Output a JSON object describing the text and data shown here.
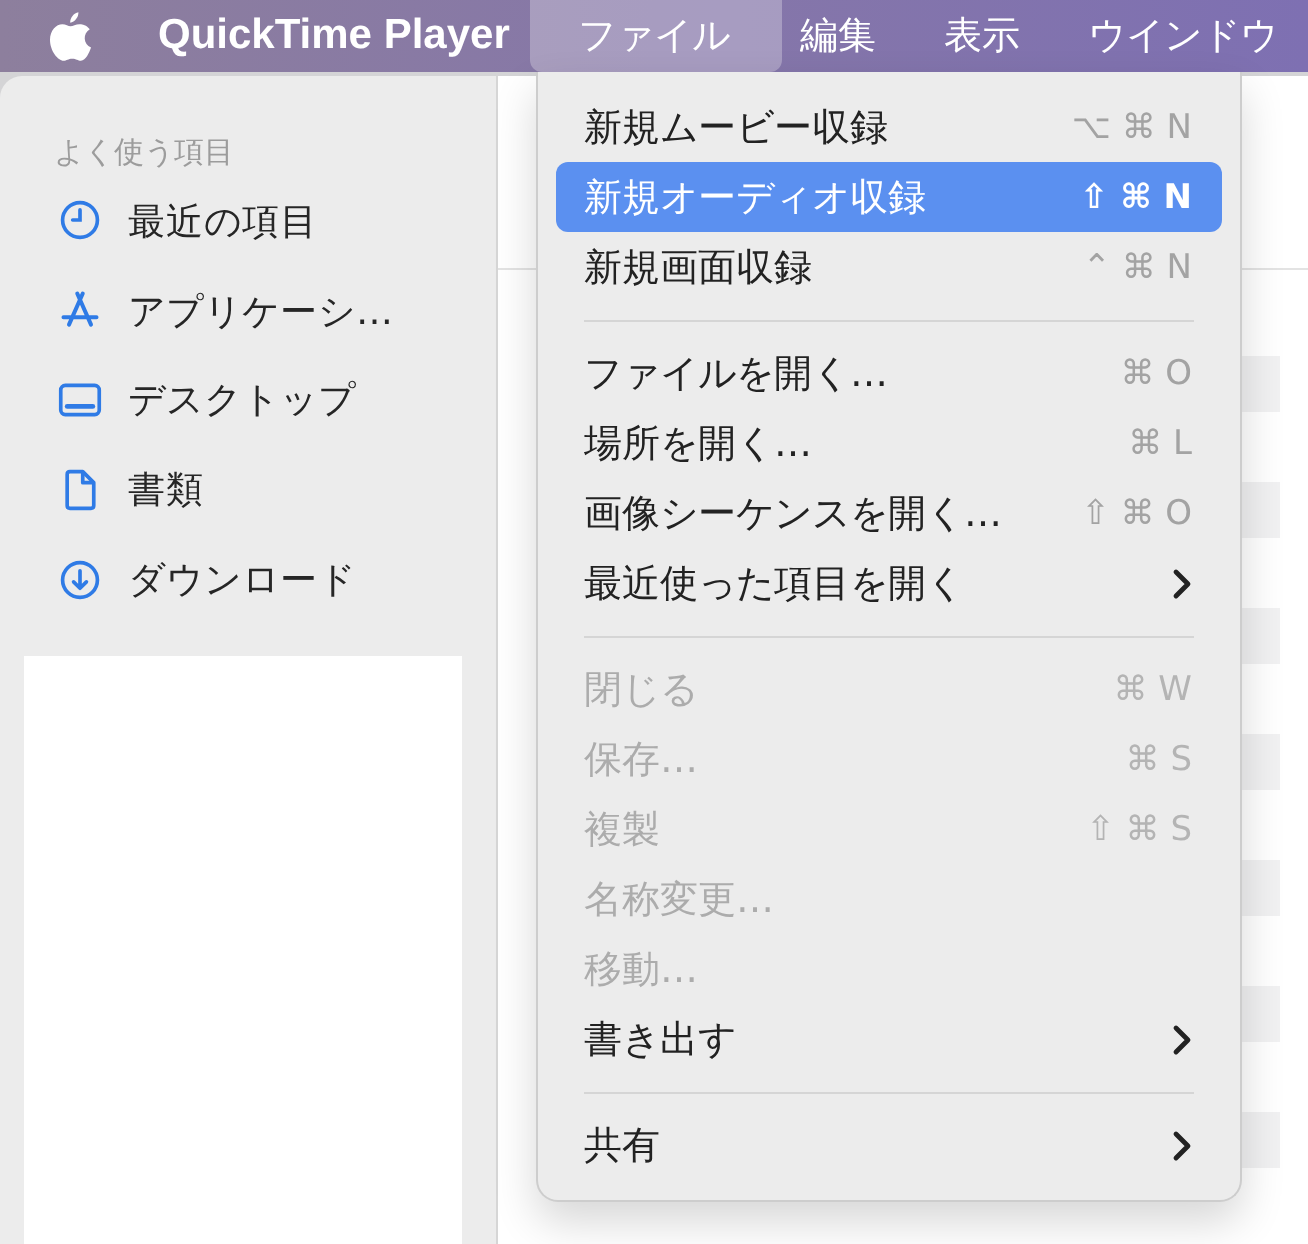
{
  "menu_bar": {
    "app_name": "QuickTime Player",
    "menus": [
      {
        "label": "ファイル",
        "selected": true
      },
      {
        "label": "編集",
        "selected": false
      },
      {
        "label": "表示",
        "selected": false
      },
      {
        "label": "ウインドウ",
        "selected": false
      }
    ]
  },
  "sidebar": {
    "section_title": "よく使う項目",
    "items": [
      {
        "label": "最近の項目"
      },
      {
        "label": "アプリケーシ…"
      },
      {
        "label": "デスクトップ"
      },
      {
        "label": "書類"
      },
      {
        "label": "ダウンロード"
      }
    ]
  },
  "file_menu": {
    "items": [
      {
        "kind": "item",
        "label": "新規ムービー収録",
        "shortcut": "⌥ ⌘ N",
        "selected": false,
        "disabled": false,
        "submenu": false
      },
      {
        "kind": "item",
        "label": "新規オーディオ収録",
        "shortcut": "⇧ ⌘ N",
        "selected": true,
        "disabled": false,
        "submenu": false
      },
      {
        "kind": "item",
        "label": "新規画面収録",
        "shortcut": "⌃ ⌘ N",
        "selected": false,
        "disabled": false,
        "submenu": false
      },
      {
        "kind": "separator"
      },
      {
        "kind": "item",
        "label": "ファイルを開く…",
        "shortcut": "⌘ O",
        "selected": false,
        "disabled": false,
        "submenu": false
      },
      {
        "kind": "item",
        "label": "場所を開く…",
        "shortcut": "⌘ L",
        "selected": false,
        "disabled": false,
        "submenu": false
      },
      {
        "kind": "item",
        "label": "画像シーケンスを開く…",
        "shortcut": "⇧ ⌘ O",
        "selected": false,
        "disabled": false,
        "submenu": false
      },
      {
        "kind": "item",
        "label": "最近使った項目を開く",
        "selected": false,
        "disabled": false,
        "submenu": true
      },
      {
        "kind": "separator"
      },
      {
        "kind": "item",
        "label": "閉じる",
        "shortcut": "⌘ W",
        "selected": false,
        "disabled": true,
        "submenu": false
      },
      {
        "kind": "item",
        "label": "保存…",
        "shortcut": "⌘ S",
        "selected": false,
        "disabled": true,
        "submenu": false
      },
      {
        "kind": "item",
        "label": "複製",
        "shortcut": "⇧ ⌘ S",
        "selected": false,
        "disabled": true,
        "submenu": false
      },
      {
        "kind": "item",
        "label": "名称変更…",
        "selected": false,
        "disabled": true,
        "submenu": false
      },
      {
        "kind": "item",
        "label": "移動…",
        "selected": false,
        "disabled": true,
        "submenu": false
      },
      {
        "kind": "item",
        "label": "書き出す",
        "selected": false,
        "disabled": false,
        "submenu": true
      },
      {
        "kind": "separator"
      },
      {
        "kind": "item",
        "label": "共有",
        "selected": false,
        "disabled": false,
        "submenu": true
      }
    ]
  }
}
